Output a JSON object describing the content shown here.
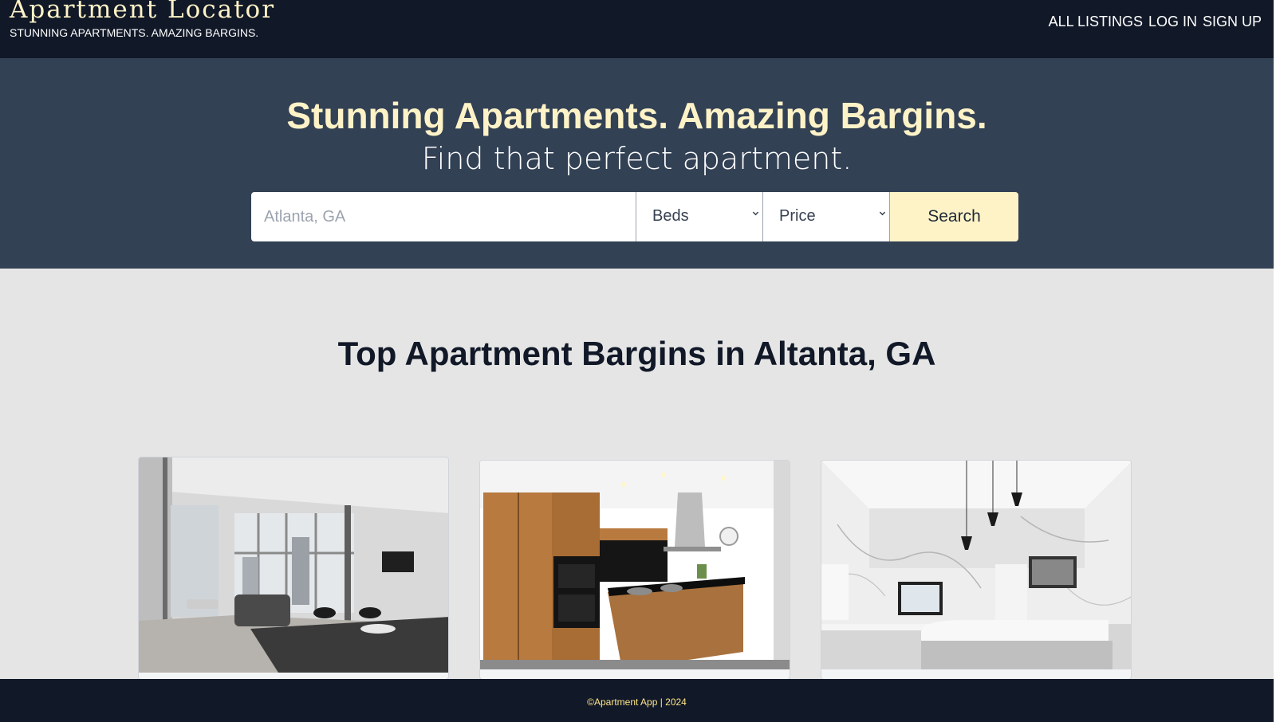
{
  "header": {
    "brand_title": "Apartment Locator",
    "brand_tagline": "STUNNING APARTMENTS. AMAZING BARGINS.",
    "nav": [
      "ALL LISTINGS",
      "LOG IN",
      "SIGN UP"
    ]
  },
  "hero": {
    "title": "Stunning Apartments. Amazing Bargins.",
    "subtitle": "Find that perfect apartment.",
    "search": {
      "location_placeholder": "Atlanta, GA",
      "beds_label": "Beds",
      "price_label": "Price",
      "button_label": "Search"
    }
  },
  "listings": {
    "heading": "Top Apartment Bargins in Altanta, GA",
    "cards": [
      {
        "photo": "living-room-photo"
      },
      {
        "photo": "kitchen-wood-photo"
      },
      {
        "photo": "kitchen-marble-photo"
      }
    ]
  },
  "footer": {
    "copyright": "©Apartment App | 2024"
  },
  "colors": {
    "nav_bg": "#111827",
    "hero_bg": "#334155",
    "accent": "#fef3c7",
    "page_bg": "#e5e5e5"
  }
}
